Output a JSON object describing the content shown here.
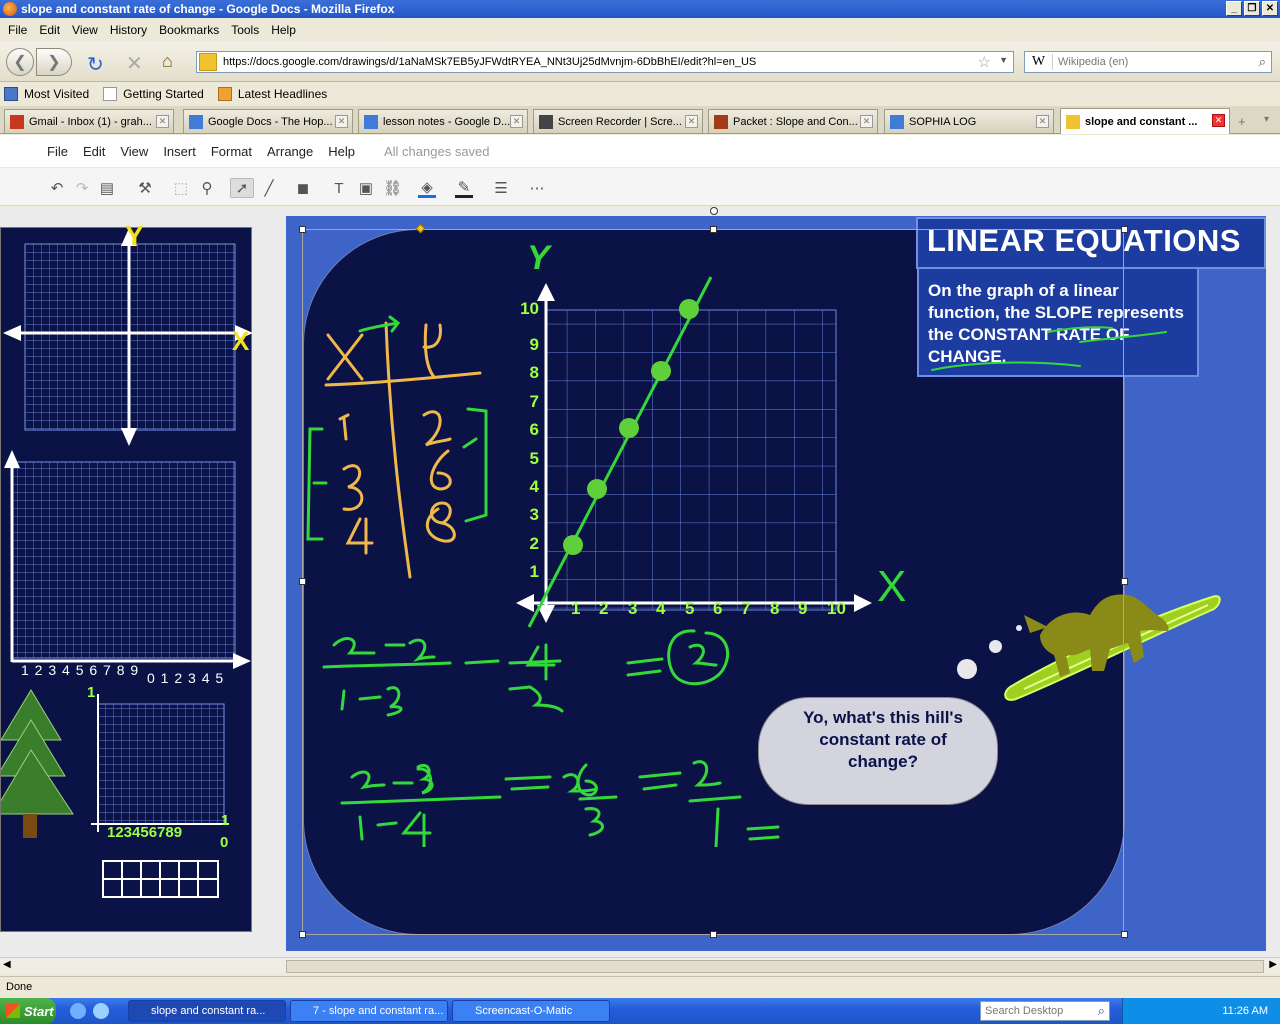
{
  "window": {
    "title": "slope and constant rate of change - Google Docs - Mozilla Firefox"
  },
  "firefox_menu": [
    "File",
    "Edit",
    "View",
    "History",
    "Bookmarks",
    "Tools",
    "Help"
  ],
  "url": "https://docs.google.com/drawings/d/1aNaMSk7EB5yJFWdtRYEA_NNt3Uj25dMvnjm-6DbBhEI/edit?hl=en_US",
  "search": {
    "placeholder": "Wikipedia (en)"
  },
  "bookmarks": [
    "Most Visited",
    "Getting Started",
    "Latest Headlines"
  ],
  "tabs": [
    {
      "label": "Gmail - Inbox (1) - grah...",
      "color": "#c7361e"
    },
    {
      "label": "Google Docs - The Hop...",
      "color": "#3e7cd8"
    },
    {
      "label": "lesson notes - Google D...",
      "color": "#3e7cd8"
    },
    {
      "label": "Screen Recorder | Scre...",
      "color": "#444444"
    },
    {
      "label": "Packet : Slope and Con...",
      "color": "#a33a1a"
    },
    {
      "label": "SOPHIA LOG",
      "color": "#3e7cd8"
    },
    {
      "label": "slope and constant ...",
      "color": "#f1c232"
    }
  ],
  "docs_menu": [
    "File",
    "Edit",
    "View",
    "Insert",
    "Format",
    "Arrange",
    "Help"
  ],
  "save_status": "All changes saved",
  "slide": {
    "title": "LINEAR EQUATIONS",
    "body": "On the graph of a linear function, the SLOPE represents the CONSTANT RATE OF CHANGE.",
    "bubble": "Yo, what's this hill's constant rate of change?",
    "y_axis_label": "Y",
    "x_axis_label": "X",
    "y_ticks": [
      "1",
      "2",
      "3",
      "4",
      "5",
      "6",
      "7",
      "8",
      "9",
      "10"
    ],
    "x_ticks": [
      "1",
      "2",
      "3",
      "4",
      "5",
      "6",
      "7",
      "8",
      "9",
      "10"
    ]
  },
  "left_panel": {
    "y_label": "Y",
    "x_label": "X",
    "axis_ticks_1": "1 2 3 4 5 6 7 8 9",
    "axis_ticks_2": "0 1 2 3 4 5",
    "small_grid_top": "1",
    "small_grid_x": "123456789",
    "small_grid_x_end": "1",
    "small_grid_zero": "0"
  },
  "status": "Done",
  "taskbar": {
    "start": "Start",
    "tasks": [
      "slope and constant ra...",
      "7 - slope and constant ra...",
      "Screencast-O-Matic"
    ],
    "search_placeholder": "Search Desktop",
    "clock": "11:26 AM"
  }
}
